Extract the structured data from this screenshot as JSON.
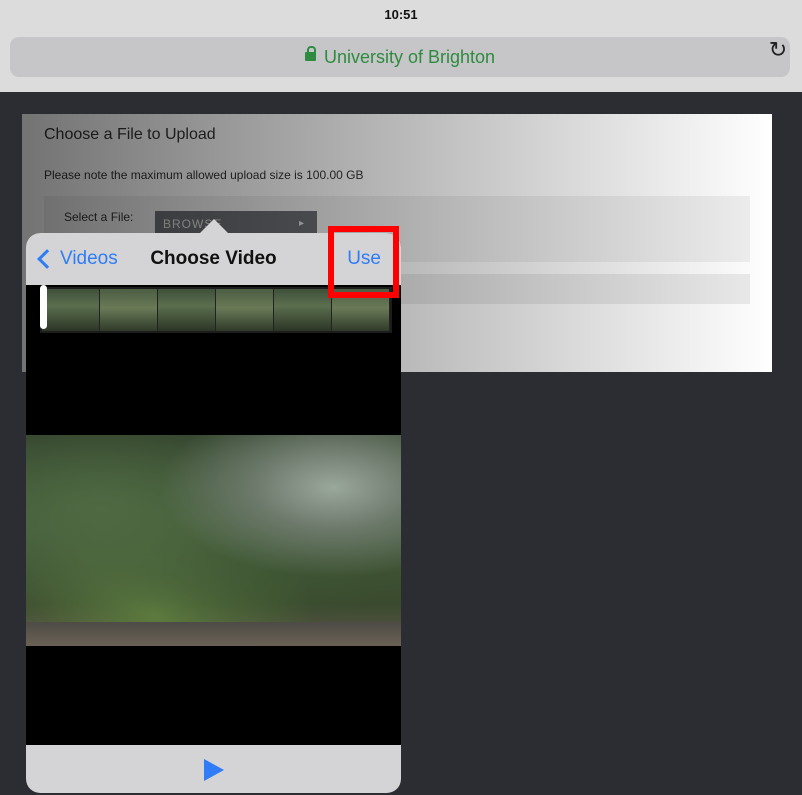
{
  "status_bar": {
    "time": "10:51"
  },
  "browser": {
    "site_title": "University of Brighton",
    "reload_glyph": "↻"
  },
  "page": {
    "heading": "Choose a File to Upload",
    "note": "Please note the maximum allowed upload size is 100.00 GB",
    "select_label": "Select a File:",
    "browse_label": "BROWSE",
    "browse_arrow": "▸"
  },
  "picker": {
    "back_label": "Videos",
    "title": "Choose Video",
    "use_label": "Use"
  },
  "icons": {
    "lock": "lock-icon",
    "reload": "reload-icon",
    "back": "chevron-left-icon",
    "play": "play-icon"
  },
  "colors": {
    "accent": "#2f7cf6",
    "secure": "#2e8b3f",
    "highlight": "#ff0000"
  }
}
